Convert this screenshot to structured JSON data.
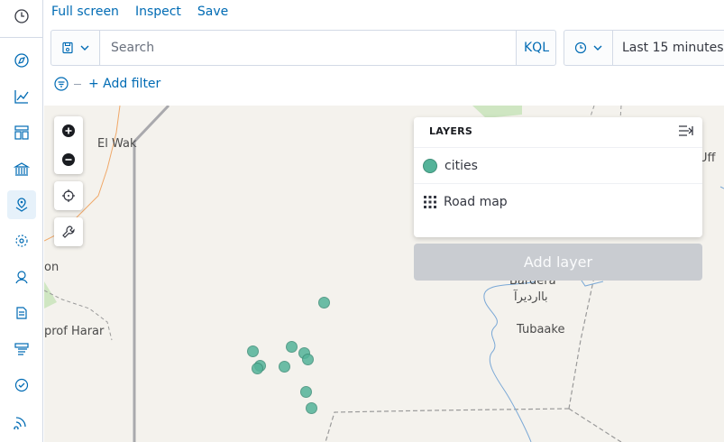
{
  "top_links": {
    "fullscreen": "Full screen",
    "inspect": "Inspect",
    "save": "Save"
  },
  "query": {
    "placeholder": "Search",
    "language": "KQL"
  },
  "time": {
    "label": "Last 15 minutes"
  },
  "filters": {
    "add_label": "+ Add filter"
  },
  "map_labels": {
    "el_wak": "El Wak",
    "on": "on",
    "harar": "prof Harar",
    "bardera": "Bardera",
    "bardera_ar": "بااردیرآ",
    "tubaake": "Tubaake",
    "uff": "Uff"
  },
  "layers": {
    "title": "LAYERS",
    "items": [
      {
        "name": "cities"
      },
      {
        "name": "Road map"
      }
    ],
    "add_button": "Add layer"
  },
  "colors": {
    "accent": "#006bb4",
    "point": "#54b399",
    "disabled": "#c9ccd1"
  },
  "icons": {
    "nav": [
      "clock-icon",
      "compass-icon",
      "chart-icon",
      "dashboard-icon",
      "bank-icon",
      "maps-icon",
      "ml-icon",
      "apm-icon",
      "logs-icon",
      "infra-icon",
      "uptime-icon",
      "signal-icon"
    ],
    "tools": [
      "zoom-in-icon",
      "zoom-out-icon",
      "crosshair-icon",
      "wrench-icon"
    ]
  }
}
